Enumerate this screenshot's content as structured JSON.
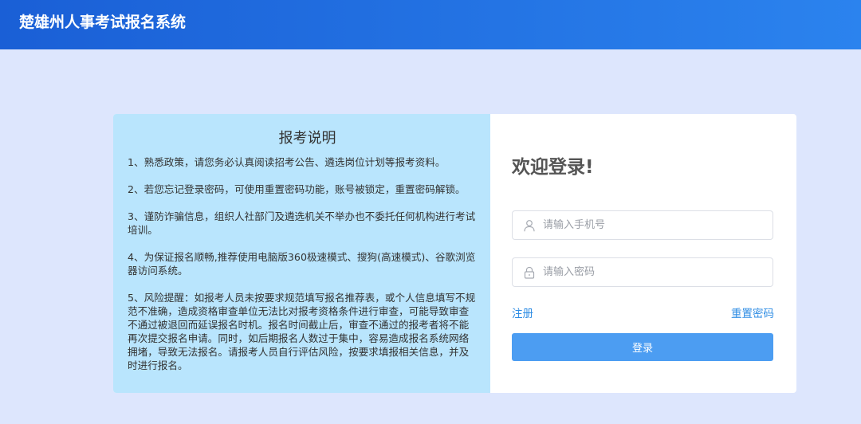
{
  "header": {
    "title": "楚雄州人事考试报名系统"
  },
  "notice": {
    "title": "报考说明",
    "items": [
      "1、熟悉政策，请您务必认真阅读招考公告、遴选岗位计划等报考资料。",
      "2、若您忘记登录密码，可使用重置密码功能，账号被锁定，重置密码解锁。",
      "3、谨防诈骗信息，组织人社部门及遴选机关不举办也不委托任何机构进行考试培训。",
      "4、为保证报名顺畅,推荐使用电脑版360极速模式、搜狗(高速模式)、谷歌浏览器访问系统。",
      "5、风险提醒：如报考人员未按要求规范填写报名推荐表，或个人信息填写不规范不准确，造成资格审查单位无法比对报考资格条件进行审查，可能导致审查不通过被退回而延误报名时机。报名时间截止后，审查不通过的报考者将不能再次提交报名申请。同时，如后期报名人数过于集中，容易造成报名系统网络拥堵，导致无法报名。请报考人员自行评估风险，按要求填报相关信息，并及时进行报名。"
    ]
  },
  "login": {
    "welcome": "欢迎登录!",
    "phone_placeholder": "请输入手机号",
    "password_placeholder": "请输入密码",
    "register_label": "注册",
    "reset_label": "重置密码",
    "submit_label": "登录",
    "icons": {
      "phone": "user-icon",
      "password": "lock-icon"
    }
  },
  "colors": {
    "header_start": "#1a5fd6",
    "header_end": "#2b83ee",
    "page_bg": "#dde6fd",
    "notice_bg": "#b9e5fd",
    "link": "#2f8de4",
    "button": "#4c9df2"
  }
}
